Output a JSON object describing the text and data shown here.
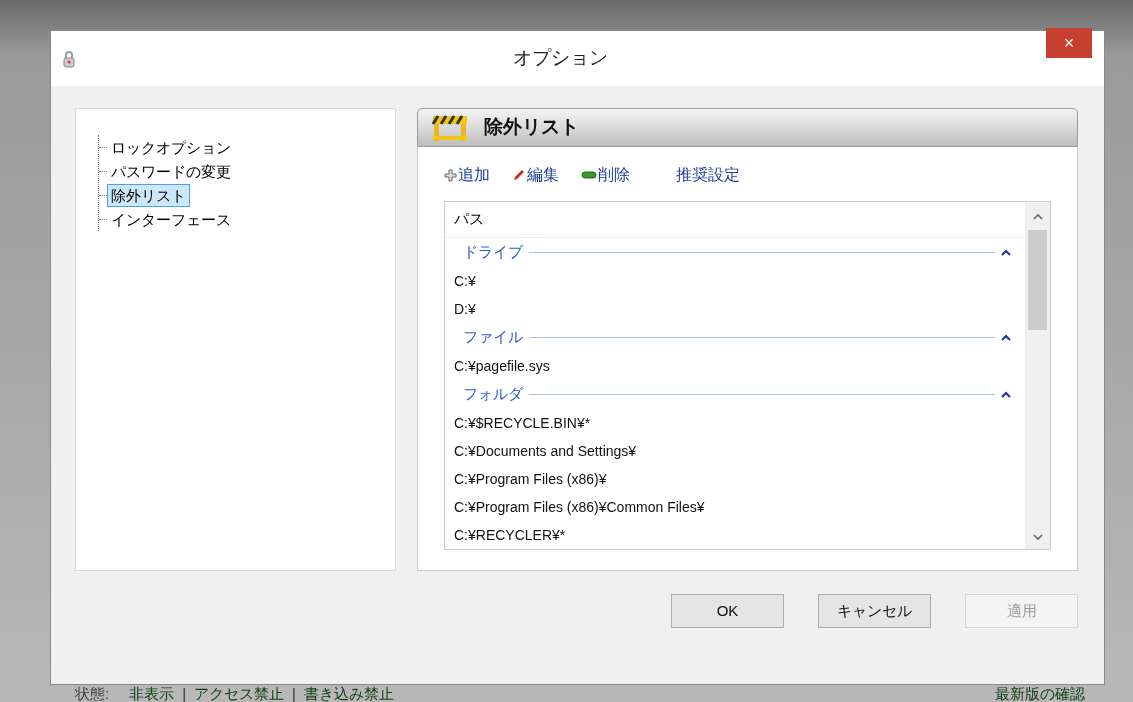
{
  "window": {
    "title": "オプション",
    "close": "×"
  },
  "tree": {
    "items": [
      {
        "label": "ロックオプション",
        "selected": false
      },
      {
        "label": "パスワードの変更",
        "selected": false
      },
      {
        "label": "除外リスト",
        "selected": true
      },
      {
        "label": "インターフェース",
        "selected": false
      }
    ]
  },
  "panel": {
    "title": "除外リスト",
    "toolbar": [
      {
        "kind": "add",
        "label": "追加"
      },
      {
        "kind": "edit",
        "label": "編集"
      },
      {
        "kind": "delete",
        "label": "削除"
      },
      {
        "kind": "plain",
        "label": "推奨設定"
      }
    ],
    "list": {
      "column": "パス",
      "groups": [
        {
          "name": "ドライブ",
          "expanded": true,
          "items": [
            "C:¥",
            "D:¥"
          ]
        },
        {
          "name": "ファイル",
          "expanded": true,
          "items": [
            "C:¥pagefile.sys"
          ]
        },
        {
          "name": "フォルダ",
          "expanded": true,
          "items": [
            "C:¥$RECYCLE.BIN¥*",
            "C:¥Documents and Settings¥",
            "C:¥Program Files (x86)¥",
            "C:¥Program Files (x86)¥Common Files¥",
            "C:¥RECYCLER¥*"
          ]
        }
      ]
    }
  },
  "buttons": [
    {
      "label": "OK",
      "disabled": false
    },
    {
      "label": "キャンセル",
      "disabled": false
    },
    {
      "label": "適用",
      "disabled": true
    }
  ],
  "status": {
    "label": "状態:",
    "separator": "|",
    "items": [
      "非表示",
      "アクセス禁止",
      "書き込み禁止"
    ],
    "update_link": "最新版の確認"
  }
}
